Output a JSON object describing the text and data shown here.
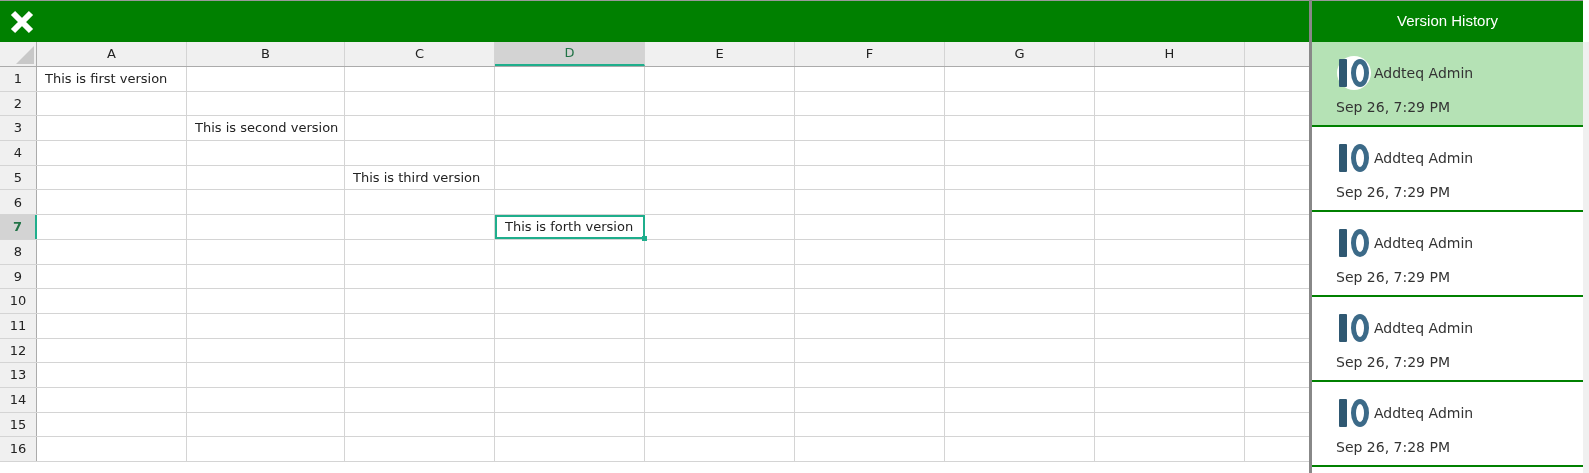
{
  "sheet": {
    "columns": [
      {
        "label": "A",
        "selected": false
      },
      {
        "label": "B",
        "selected": false
      },
      {
        "label": "C",
        "selected": false
      },
      {
        "label": "D",
        "selected": true
      },
      {
        "label": "E",
        "selected": false
      },
      {
        "label": "F",
        "selected": false
      },
      {
        "label": "G",
        "selected": false
      },
      {
        "label": "H",
        "selected": false
      }
    ],
    "rows": [
      {
        "label": "1",
        "selected": false,
        "cells": [
          "This is first version",
          null,
          null,
          null,
          null,
          null,
          null,
          null
        ]
      },
      {
        "label": "2",
        "selected": false,
        "cells": [
          null,
          null,
          null,
          null,
          null,
          null,
          null,
          null
        ]
      },
      {
        "label": "3",
        "selected": false,
        "cells": [
          null,
          "This is second version",
          null,
          null,
          null,
          null,
          null,
          null
        ]
      },
      {
        "label": "4",
        "selected": false,
        "cells": [
          null,
          null,
          null,
          null,
          null,
          null,
          null,
          null
        ]
      },
      {
        "label": "5",
        "selected": false,
        "cells": [
          null,
          null,
          "This is third version",
          null,
          null,
          null,
          null,
          null
        ]
      },
      {
        "label": "6",
        "selected": false,
        "cells": [
          null,
          null,
          null,
          null,
          null,
          null,
          null,
          null
        ]
      },
      {
        "label": "7",
        "selected": true,
        "cells": [
          null,
          null,
          null,
          "This is forth version",
          null,
          null,
          null,
          null
        ]
      },
      {
        "label": "8",
        "selected": false,
        "cells": [
          null,
          null,
          null,
          null,
          null,
          null,
          null,
          null
        ]
      },
      {
        "label": "9",
        "selected": false,
        "cells": [
          null,
          null,
          null,
          null,
          null,
          null,
          null,
          null
        ]
      },
      {
        "label": "10",
        "selected": false,
        "cells": [
          null,
          null,
          null,
          null,
          null,
          null,
          null,
          null
        ]
      },
      {
        "label": "11",
        "selected": false,
        "cells": [
          null,
          null,
          null,
          null,
          null,
          null,
          null,
          null
        ]
      },
      {
        "label": "12",
        "selected": false,
        "cells": [
          null,
          null,
          null,
          null,
          null,
          null,
          null,
          null
        ]
      },
      {
        "label": "13",
        "selected": false,
        "cells": [
          null,
          null,
          null,
          null,
          null,
          null,
          null,
          null
        ]
      },
      {
        "label": "14",
        "selected": false,
        "cells": [
          null,
          null,
          null,
          null,
          null,
          null,
          null,
          null
        ]
      },
      {
        "label": "15",
        "selected": false,
        "cells": [
          null,
          null,
          null,
          null,
          null,
          null,
          null,
          null
        ]
      },
      {
        "label": "16",
        "selected": false,
        "cells": [
          null,
          null,
          null,
          null,
          null,
          null,
          null,
          null
        ]
      }
    ]
  },
  "version_history": {
    "title": "Version History",
    "items": [
      {
        "author": "Addteq Admin",
        "time": "Sep 26, 7:29 PM",
        "selected": true
      },
      {
        "author": "Addteq Admin",
        "time": "Sep 26, 7:29 PM",
        "selected": false
      },
      {
        "author": "Addteq Admin",
        "time": "Sep 26, 7:29 PM",
        "selected": false
      },
      {
        "author": "Addteq Admin",
        "time": "Sep 26, 7:29 PM",
        "selected": false
      },
      {
        "author": "Addteq Admin",
        "time": "Sep 26, 7:28 PM",
        "selected": false
      }
    ]
  }
}
